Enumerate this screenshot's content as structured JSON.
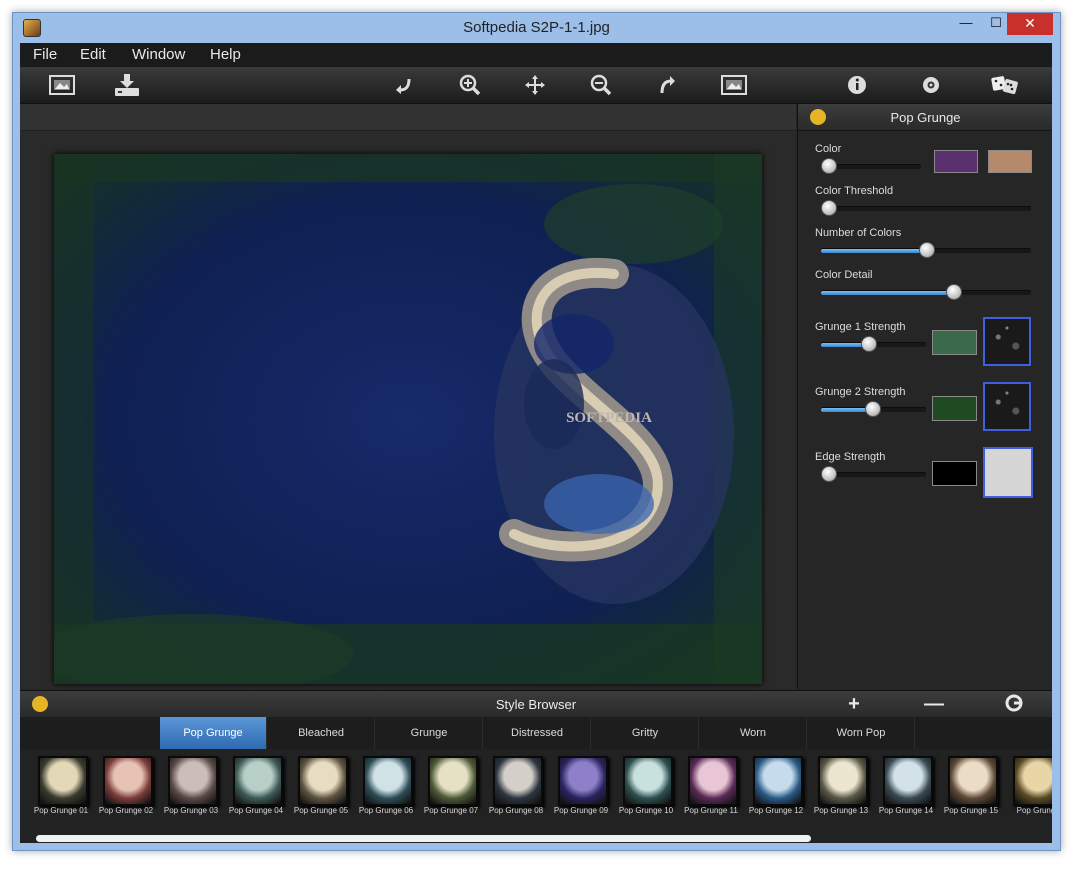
{
  "window": {
    "title": "Softpedia S2P-1-1.jpg"
  },
  "menu": [
    "File",
    "Edit",
    "Window",
    "Help"
  ],
  "toolbar": {
    "left": [
      "open-image-icon",
      "save-icon"
    ],
    "center": [
      "rotate-left-icon",
      "zoom-in-icon",
      "pan-icon",
      "zoom-out-icon",
      "rotate-right-icon",
      "fit-image-icon"
    ],
    "right": [
      "info-icon",
      "settings-icon",
      "dice-icon"
    ]
  },
  "panel": {
    "title": "Pop Grunge",
    "controls": [
      {
        "label": "Color",
        "value": 0.05,
        "swatches": [
          "#5a2f6e",
          "#b5896a"
        ]
      },
      {
        "label": "Color Threshold",
        "value": 0.0
      },
      {
        "label": "Number of Colors",
        "value": 0.5
      },
      {
        "label": "Color Detail",
        "value": 0.63
      },
      {
        "label": "Grunge 1 Strength",
        "value": 0.45,
        "swatch": "#3b6a4a",
        "texture": "grunge-texture-1"
      },
      {
        "label": "Grunge 2 Strength",
        "value": 0.49,
        "swatch": "#1f4a22",
        "texture": "grunge-texture-2"
      },
      {
        "label": "Edge Strength",
        "value": 0.0,
        "swatch": "#000000",
        "texture_color": "#d6d6d6"
      }
    ]
  },
  "image": {
    "watermark": "SOFTPEDIA"
  },
  "browser": {
    "title": "Style Browser",
    "tabs": [
      "Pop Grunge",
      "Bleached",
      "Grunge",
      "Distressed",
      "Gritty",
      "Worn",
      "Worn Pop"
    ],
    "active_tab": 0,
    "thumbnails": [
      {
        "label": "Pop Grunge 01",
        "c1": "#e3d9b8",
        "c2": "#3a3a2e"
      },
      {
        "label": "Pop Grunge 02",
        "c1": "#e7c3b6",
        "c2": "#7a3d3a"
      },
      {
        "label": "Pop Grunge 03",
        "c1": "#cdbdb8",
        "c2": "#5a4a48"
      },
      {
        "label": "Pop Grunge 04",
        "c1": "#b8cfc8",
        "c2": "#3d5a55"
      },
      {
        "label": "Pop Grunge 05",
        "c1": "#e8ddc2",
        "c2": "#5e5440"
      },
      {
        "label": "Pop Grunge 06",
        "c1": "#d0e2e6",
        "c2": "#2e4e58"
      },
      {
        "label": "Pop Grunge 07",
        "c1": "#e6e1c4",
        "c2": "#4e5a38"
      },
      {
        "label": "Pop Grunge 08",
        "c1": "#d4cfc8",
        "c2": "#2d3540"
      },
      {
        "label": "Pop Grunge 09",
        "c1": "#8d80c8",
        "c2": "#2a2460"
      },
      {
        "label": "Pop Grunge 10",
        "c1": "#c8e0de",
        "c2": "#2c504e"
      },
      {
        "label": "Pop Grunge 11",
        "c1": "#e8c6d6",
        "c2": "#5a2a56"
      },
      {
        "label": "Pop Grunge 12",
        "c1": "#c6dcec",
        "c2": "#2a5a86"
      },
      {
        "label": "Pop Grunge 13",
        "c1": "#ece6d0",
        "c2": "#5a5846"
      },
      {
        "label": "Pop Grunge 14",
        "c1": "#d2e2e8",
        "c2": "#3a4a52"
      },
      {
        "label": "Pop Grunge 15",
        "c1": "#eadcc6",
        "c2": "#5e4a36"
      },
      {
        "label": "Pop Grung",
        "c1": "#e8d6a6",
        "c2": "#5a4a26"
      }
    ],
    "scroll": 0.76
  }
}
